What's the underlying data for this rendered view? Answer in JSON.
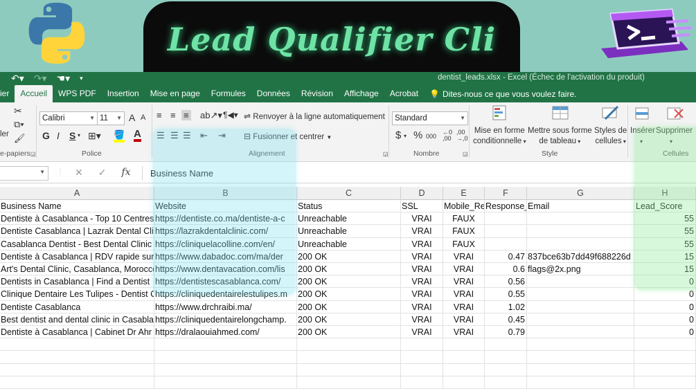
{
  "banner": {
    "title": "Lead Qualifier Cli",
    "python_logo": "python-logo",
    "terminal_logo": "terminal-logo"
  },
  "excel": {
    "window_title": "dentist_leads.xlsx - Excel (Échec de l'activation du produit)",
    "tabs": [
      "ier",
      "Accueil",
      "WPS PDF",
      "Insertion",
      "Mise en page",
      "Formules",
      "Données",
      "Révision",
      "Affichage",
      "Acrobat"
    ],
    "active_tab": "Accueil",
    "tell_me": "Dites-nous ce que vous voulez faire.",
    "ribbon": {
      "clipboard_label": "e-papiers",
      "paste_partial": "ler",
      "font_name": "Calibri",
      "font_size": "11",
      "font_group_label": "Police",
      "bold": "G",
      "italic": "I",
      "underline": "S",
      "grow_font": "A",
      "shrink_font": "A",
      "wrap_text": "Renvoyer à la ligne automatiquement",
      "merge_center": "Fusionner et centrer",
      "alignment_label": "Alignement",
      "number_format": "Standard",
      "currency": "$",
      "percent": "%",
      "thousands": "000",
      "inc_decimal": "+0 ,00",
      "dec_decimal": ",00 →,0",
      "number_label": "Nombre",
      "cond_format_1": "Mise en forme",
      "cond_format_2": "conditionnelle",
      "format_table_1": "Mettre sous forme",
      "format_table_2": "de tableau",
      "cell_styles_1": "Styles de",
      "cell_styles_2": "cellules",
      "style_label": "Style",
      "insert": "Insérer",
      "delete": "Supprimer",
      "cells_label": "Cellules",
      "accent_font_color": "#c00000",
      "accent_fill_color": "#ffff00"
    },
    "formula_bar": {
      "name_box": "",
      "cancel": "✕",
      "enter": "✓",
      "fx": "fx",
      "content": "Business Name"
    },
    "columns": [
      "A",
      "B",
      "C",
      "D",
      "E",
      "F",
      "G",
      "H"
    ],
    "header_row": [
      "Business Name",
      "Website",
      "Status",
      "SSL",
      "Mobile_Re",
      "Response_",
      "Email",
      "Lead_Score"
    ],
    "rows": [
      [
        "Dentiste à Casablanca - Top 10 Centres",
        "https://dentiste.co.ma/dentiste-a-c",
        "Unreachable",
        "VRAI",
        "FAUX",
        "",
        "",
        "55"
      ],
      [
        "Dentiste Casablanca | Lazrak Dental Cli",
        "https://lazrakdentalclinic.com/",
        "Unreachable",
        "VRAI",
        "FAUX",
        "",
        "",
        "55"
      ],
      [
        "Casablanca Dentist - Best Dental Clinic i",
        "https://cliniquelacolline.com/en/",
        "Unreachable",
        "VRAI",
        "FAUX",
        "",
        "",
        "55"
      ],
      [
        "Dentiste à Casablanca | RDV rapide sur",
        "https://www.dabadoc.com/ma/der",
        "200 OK",
        "VRAI",
        "VRAI",
        "0.47",
        "837bce63b7dd49f688226d",
        "15"
      ],
      [
        "Art's Dental Clinic, Casablanca, Morocco",
        "https://www.dentavacation.com/lis",
        "200 OK",
        "VRAI",
        "VRAI",
        "0.6",
        "flags@2x.png",
        "15"
      ],
      [
        "Dentists in Casablanca | Find a Dentist",
        "https://dentistescasablanca.com/",
        "200 OK",
        "VRAI",
        "VRAI",
        "0.56",
        "",
        "0"
      ],
      [
        "Clinique Dentaire Les Tulipes - Dentist C",
        "https://cliniquedentairelestulipes.m",
        "200 OK",
        "VRAI",
        "VRAI",
        "0.55",
        "",
        "0"
      ],
      [
        "Dentiste Casablanca",
        "https://www.drchraibi.ma/",
        "200 OK",
        "VRAI",
        "VRAI",
        "1.02",
        "",
        "0"
      ],
      [
        "Best dentist and dental clinic in Casabla",
        "https://cliniquedentairelongchamp.",
        "200 OK",
        "VRAI",
        "VRAI",
        "0.45",
        "",
        "0"
      ],
      [
        "Dentiste à Casablanca | Cabinet Dr Ahr",
        "https://dralaouiahmed.com/",
        "200 OK",
        "VRAI",
        "VRAI",
        "0.79",
        "",
        "0"
      ]
    ]
  }
}
